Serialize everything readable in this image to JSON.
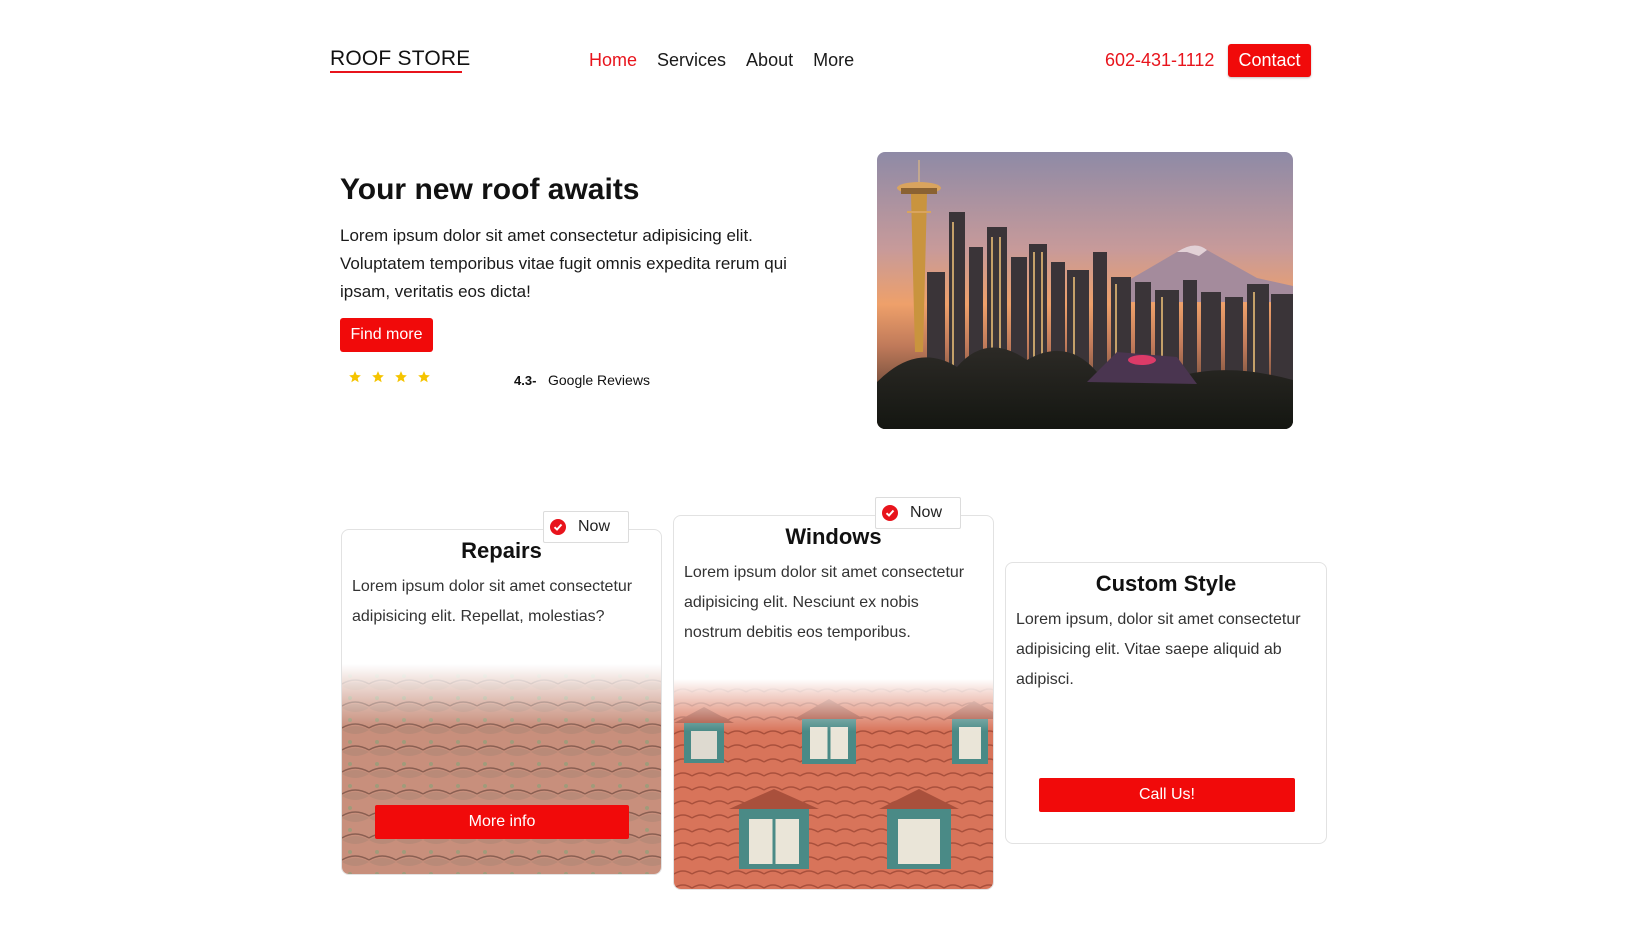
{
  "header": {
    "logo": "ROOF STORE",
    "nav": [
      "Home",
      "Services",
      "About",
      "More"
    ],
    "active_nav": "Home",
    "phone": "602-431-1112",
    "contact_label": "Contact"
  },
  "hero": {
    "title": "Your new roof awaits",
    "text": "Lorem ipsum dolor sit amet consectetur adipisicing elit. Voluptatem temporibus vitae fugit omnis expedita rerum qui ipsam, veritatis eos dicta!",
    "button": "Find more",
    "stars": 4,
    "rating": "4.3-",
    "reviews_label": "Google Reviews"
  },
  "cards": [
    {
      "title": "Repairs",
      "text": "Lorem ipsum dolor sit amet consectetur adipisicing elit. Repellat, molestias?",
      "badge": "Now",
      "button": "More info"
    },
    {
      "title": "Windows",
      "text": "Lorem ipsum dolor sit amet consectetur adipisicing elit. Nesciunt ex nobis nostrum debitis eos temporibus.",
      "badge": "Now"
    },
    {
      "title": "Custom Style",
      "text": "Lorem ipsum, dolor sit amet consectetur adipisicing elit. Vitae saepe aliquid ab adipisci.",
      "button": "Call Us!"
    }
  ],
  "colors": {
    "accent": "#f10a0a",
    "nav_active": "#e8141c",
    "star": "#f5c400"
  },
  "icons": [
    "check-circle-icon",
    "star-icon"
  ]
}
